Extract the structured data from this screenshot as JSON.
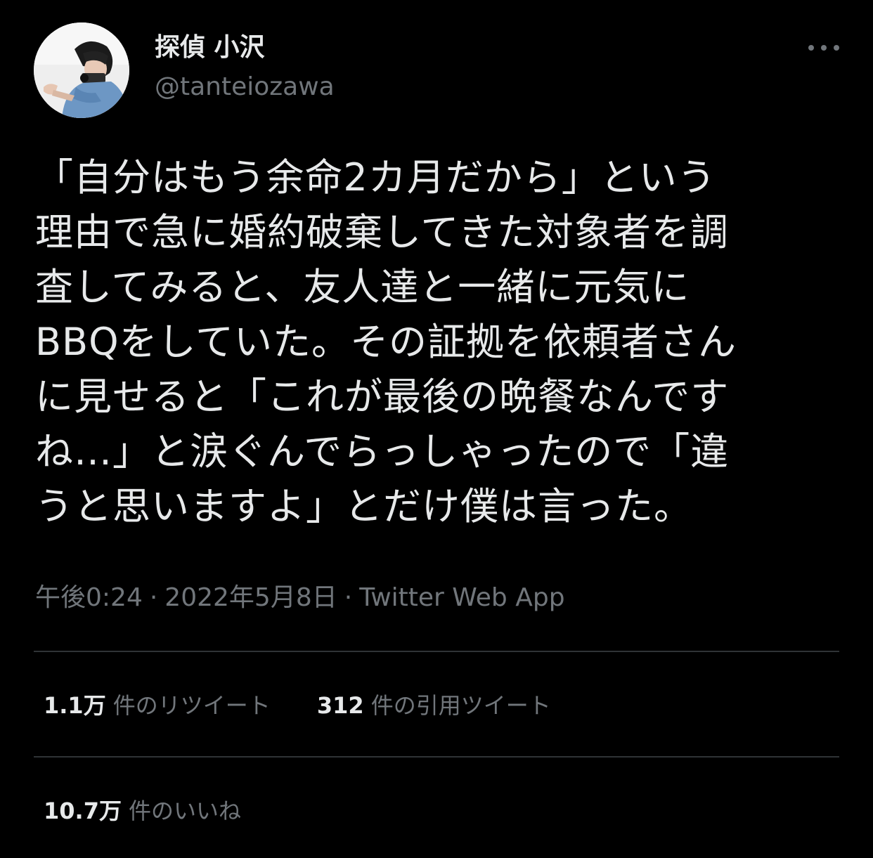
{
  "author": {
    "display_name": "探偵 小沢",
    "handle": "@tanteiozawa",
    "avatar_icon": "user-avatar-photo"
  },
  "more_icon": "more-horizontal-icon",
  "tweet": {
    "lines": [
      "「自分はもう余命2カ月だから」という",
      "理由で急に婚約破棄してきた対象者を調",
      "査してみると、友人達と一緒に元気に",
      "BBQをしていた。その証拠を依頼者さん",
      "に見せると「これが最後の晩餐なんです",
      "ね…」と涙ぐんでらっしゃったので「違",
      "うと思いますよ」とだけ僕は言った。"
    ]
  },
  "meta": {
    "time": "午後0:24",
    "separator": "·",
    "date": "2022年5月8日",
    "source": "Twitter Web App"
  },
  "stats": {
    "retweets": {
      "count": "1.1万",
      "label": "件のリツイート"
    },
    "quotes": {
      "count": "312",
      "label": "件の引用ツイート"
    },
    "likes": {
      "count": "10.7万",
      "label": "件のいいね"
    }
  },
  "colors": {
    "background": "#000000",
    "primary_text": "#e7e9ea",
    "secondary_text": "#71767b",
    "divider": "#2f3336"
  }
}
